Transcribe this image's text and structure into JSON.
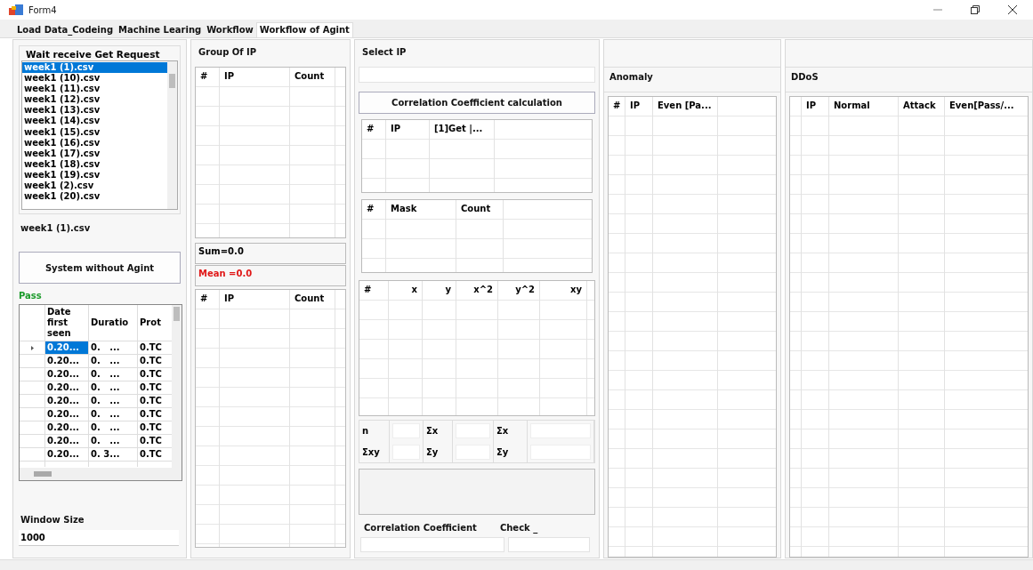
{
  "window": {
    "title": "Form4"
  },
  "tabs": [
    {
      "label": "Load Data_Codeing",
      "selected": false
    },
    {
      "label": "Machine Learing",
      "selected": false
    },
    {
      "label": "Workflow",
      "selected": false
    },
    {
      "label": "Workflow of Agint",
      "selected": true
    }
  ],
  "request_group": {
    "title": "Wait  receive Get Request",
    "files": [
      {
        "label": "week1 (1).csv",
        "selected": true
      },
      {
        "label": "week1 (10).csv",
        "selected": false
      },
      {
        "label": "week1 (11).csv",
        "selected": false
      },
      {
        "label": "week1 (12).csv",
        "selected": false
      },
      {
        "label": "week1 (13).csv",
        "selected": false
      },
      {
        "label": "week1 (14).csv",
        "selected": false
      },
      {
        "label": "week1 (15).csv",
        "selected": false
      },
      {
        "label": "week1 (16).csv",
        "selected": false
      },
      {
        "label": "week1 (17).csv",
        "selected": false
      },
      {
        "label": "week1 (18).csv",
        "selected": false
      },
      {
        "label": "week1 (19).csv",
        "selected": false
      },
      {
        "label": "week1 (2).csv",
        "selected": false
      },
      {
        "label": "week1 (20).csv",
        "selected": false
      }
    ]
  },
  "selected_file": "week1 (1).csv",
  "system_button": "System without Agint",
  "pass_label": "Pass",
  "flow_grid": {
    "columns": [
      "Date first seen",
      "Duratio",
      "Prot"
    ],
    "rows": [
      {
        "selected": true,
        "cells": [
          "0.20...",
          "0.   ...",
          "0.TC"
        ]
      },
      {
        "selected": false,
        "cells": [
          "0.20...",
          "0.   ...",
          "0.TC"
        ]
      },
      {
        "selected": false,
        "cells": [
          "0.20...",
          "0.   ...",
          "0.TC"
        ]
      },
      {
        "selected": false,
        "cells": [
          "0.20...",
          "0.   ...",
          "0.TC"
        ]
      },
      {
        "selected": false,
        "cells": [
          "0.20...",
          "0.   ...",
          "0.TC"
        ]
      },
      {
        "selected": false,
        "cells": [
          "0.20...",
          "0.   ...",
          "0.TC"
        ]
      },
      {
        "selected": false,
        "cells": [
          "0.20...",
          "0.   ...",
          "0.TC"
        ]
      },
      {
        "selected": false,
        "cells": [
          "0.20...",
          "0.   ...",
          "0.TC"
        ]
      },
      {
        "selected": false,
        "cells": [
          "0.20...",
          "0. 3...",
          "0.TC"
        ]
      }
    ]
  },
  "window_size": {
    "label": "Window Size",
    "value": "1000"
  },
  "group_of_ip": {
    "title": "Group Of IP",
    "columns": [
      "#",
      "IP",
      "Count"
    ]
  },
  "sum": "Sum=0.0",
  "mean": "Mean =0.0",
  "lower_ip_grid": {
    "columns": [
      "#",
      "IP",
      "Count"
    ]
  },
  "select_ip": {
    "label": "Select IP"
  },
  "correlation_button": "Correlation Coefficient calculation",
  "get_grid": {
    "columns": [
      "#",
      "IP",
      "[1]Get |..."
    ]
  },
  "mask_grid": {
    "columns": [
      "#",
      "Mask",
      "Count"
    ]
  },
  "xy_grid": {
    "columns": [
      "#",
      "x",
      "y",
      "x^2",
      "y^2",
      "xy"
    ]
  },
  "sums": [
    {
      "label": "n"
    },
    {
      "label": "Σx"
    },
    {
      "label": "Σx"
    },
    {
      "label": "Σxy"
    },
    {
      "label": "Σy"
    },
    {
      "label": "Σy"
    }
  ],
  "correlation": {
    "label": "Correlation Coefficient",
    "check_label": "Check _"
  },
  "anomaly": {
    "title": "Anomaly",
    "columns": [
      "#",
      "IP",
      "Even [Pa..."
    ]
  },
  "ddos": {
    "title": "DDoS",
    "columns": [
      "IP",
      "Normal",
      "Attack",
      "Even[Pass/..."
    ]
  }
}
